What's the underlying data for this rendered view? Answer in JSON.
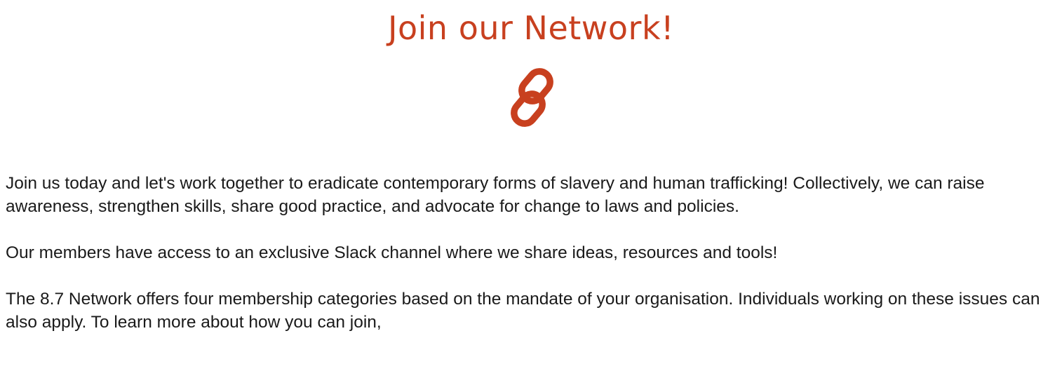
{
  "section": {
    "title": "Join our Network!",
    "icon": "link-icon",
    "accent_color": "#c8401f"
  },
  "content": {
    "paragraph_1": "Join us today and let's work together to eradicate contemporary forms of slavery and human trafficking! Collectively, we can raise awareness, strengthen skills, share good practice, and advocate for change to laws and policies.",
    "paragraph_2": "Our members have access to an exclusive Slack channel where we share ideas, resources and tools!",
    "paragraph_3": "The 8.7 Network offers four membership categories based on the mandate of your organisation. Individuals working on these issues can also apply. To learn more about how you can join,"
  }
}
